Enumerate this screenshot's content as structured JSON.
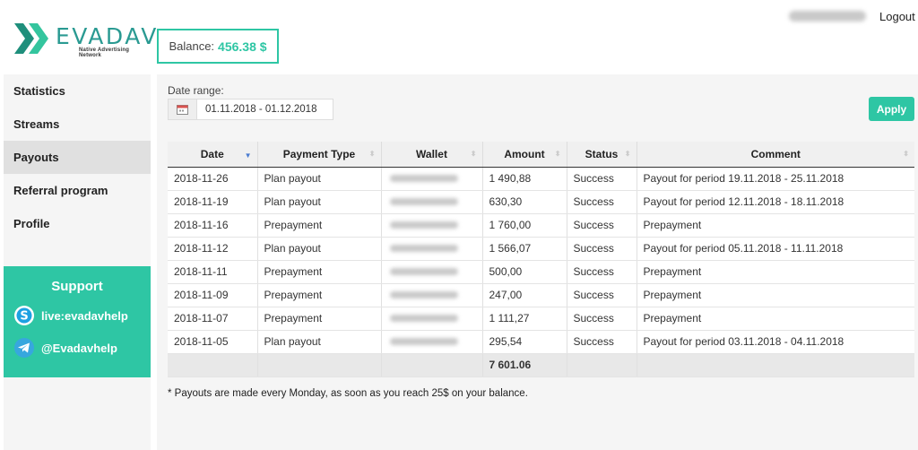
{
  "brand": {
    "name": "EVADAV",
    "tagline": "Native Advertising Network",
    "color": "#2a9a92"
  },
  "balance": {
    "label": "Balance:",
    "value": "456.38 $",
    "accent": "#2ec6a4"
  },
  "header": {
    "logout": "Logout"
  },
  "sidebar": {
    "items": [
      {
        "label": "Statistics"
      },
      {
        "label": "Streams"
      },
      {
        "label": "Payouts"
      },
      {
        "label": "Referral program"
      },
      {
        "label": "Profile"
      }
    ],
    "active_index": 2,
    "support": {
      "title": "Support",
      "skype": {
        "icon": "skype-icon",
        "label": "live:evadavhelp"
      },
      "telegram": {
        "icon": "telegram-icon",
        "label": "@Evadavhelp"
      }
    }
  },
  "filters": {
    "date_label": "Date range:",
    "date_value": "01.11.2018 - 01.12.2018",
    "apply_label": "Apply"
  },
  "table": {
    "columns": [
      "Date",
      "Payment Type",
      "Wallet",
      "Amount",
      "Status",
      "Comment"
    ],
    "rows": [
      {
        "date": "2018-11-26",
        "type": "Plan payout",
        "amount": "1 490,88",
        "status": "Success",
        "comment": "Payout for period 19.11.2018 - 25.11.2018"
      },
      {
        "date": "2018-11-19",
        "type": "Plan payout",
        "amount": "630,30",
        "status": "Success",
        "comment": "Payout for period 12.11.2018 - 18.11.2018"
      },
      {
        "date": "2018-11-16",
        "type": "Prepayment",
        "amount": "1 760,00",
        "status": "Success",
        "comment": "Prepayment"
      },
      {
        "date": "2018-11-12",
        "type": "Plan payout",
        "amount": "1 566,07",
        "status": "Success",
        "comment": "Payout for period 05.11.2018 - 11.11.2018"
      },
      {
        "date": "2018-11-11",
        "type": "Prepayment",
        "amount": "500,00",
        "status": "Success",
        "comment": "Prepayment"
      },
      {
        "date": "2018-11-09",
        "type": "Prepayment",
        "amount": "247,00",
        "status": "Success",
        "comment": "Prepayment"
      },
      {
        "date": "2018-11-07",
        "type": "Prepayment",
        "amount": "1 111,27",
        "status": "Success",
        "comment": "Prepayment"
      },
      {
        "date": "2018-11-05",
        "type": "Plan payout",
        "amount": "295,54",
        "status": "Success",
        "comment": "Payout for period 03.11.2018 - 04.11.2018"
      }
    ],
    "total": "7 601.06"
  },
  "note": "* Payouts are made every Monday, as soon as you reach 25$ on your balance."
}
